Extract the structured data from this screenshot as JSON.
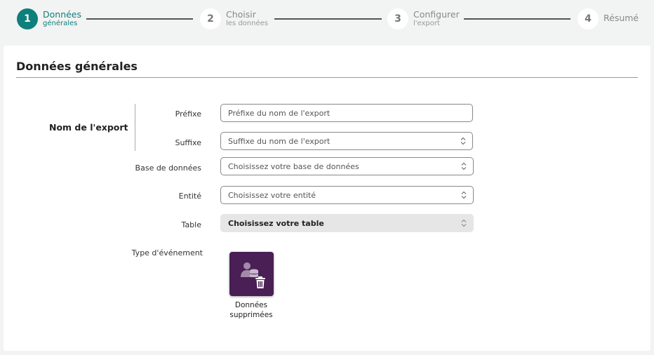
{
  "stepper": {
    "steps": [
      {
        "number": "1",
        "title": "Données",
        "subtitle": "générales",
        "active": true
      },
      {
        "number": "2",
        "title": "Choisir",
        "subtitle": "les données",
        "active": false
      },
      {
        "number": "3",
        "title": "Configurer",
        "subtitle": "l'export",
        "active": false
      },
      {
        "number": "4",
        "title": "Résumé",
        "subtitle": "",
        "active": false
      }
    ]
  },
  "form": {
    "title": "Données générales",
    "group_label": "Nom de l'export",
    "prefix": {
      "label": "Préfixe",
      "placeholder": "Préfixe du nom de l'export"
    },
    "suffix": {
      "label": "Suffixe",
      "placeholder": "Suffixe du nom de l'export"
    },
    "database": {
      "label": "Base de données",
      "placeholder": "Choisissez votre base de données"
    },
    "entity": {
      "label": "Entité",
      "placeholder": "Choisissez votre entité"
    },
    "table": {
      "label": "Table",
      "placeholder": "Choisissez votre table"
    },
    "event_type": {
      "label": "Type d'événement",
      "option_label_line1": "Données",
      "option_label_line2": "supprimées",
      "icon": "deleted-data-icon"
    }
  },
  "colors": {
    "accent": "#0e7f7b",
    "tile": "#4a1f55"
  }
}
